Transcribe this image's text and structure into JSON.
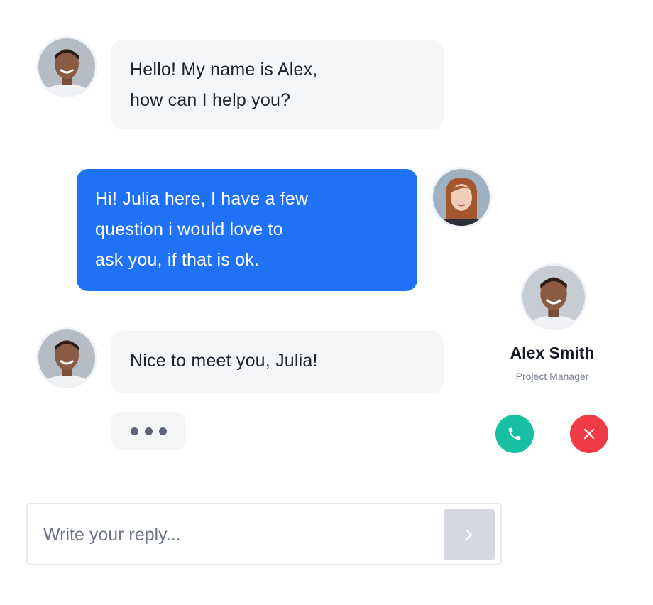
{
  "messages": [
    {
      "from": "Alex",
      "lines": [
        "Hello! My name is Alex,",
        "how can I help you?"
      ]
    },
    {
      "from": "Julia",
      "lines": [
        "Hi! Julia here, I have a few",
        "question i would love to",
        "ask you, if that is ok."
      ]
    },
    {
      "from": "Alex",
      "lines": [
        "Nice to meet you, Julia!"
      ]
    }
  ],
  "contact": {
    "name": "Alex Smith",
    "role": "Project Manager"
  },
  "composer": {
    "placeholder": "Write your reply...",
    "value": ""
  },
  "colors": {
    "accent": "#1f72f5",
    "incoming_bubble": "#f5f6f8",
    "call": "#17bfa3",
    "decline": "#ef3b45",
    "send_disabled": "#d5d8e0"
  },
  "icons": {
    "call": "phone-icon",
    "decline": "close-icon",
    "send": "chevron-right-icon",
    "typing": "typing-indicator"
  }
}
